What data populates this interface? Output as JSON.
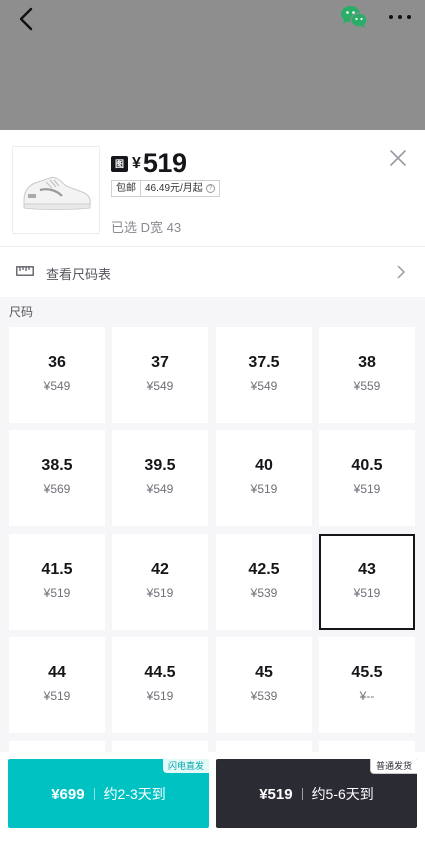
{
  "product": {
    "badge": "图鞋",
    "currency": "¥",
    "price": "519",
    "tag_shipping": "包邮",
    "tag_installment": "46.49元/月起",
    "selected": "已选 D宽 43"
  },
  "size_chart": {
    "label": "查看尺码表"
  },
  "sizes": {
    "title": "尺码",
    "items": [
      {
        "size": "36",
        "price": "¥549"
      },
      {
        "size": "37",
        "price": "¥549"
      },
      {
        "size": "37.5",
        "price": "¥549"
      },
      {
        "size": "38",
        "price": "¥559"
      },
      {
        "size": "38.5",
        "price": "¥569"
      },
      {
        "size": "39.5",
        "price": "¥549"
      },
      {
        "size": "40",
        "price": "¥519"
      },
      {
        "size": "40.5",
        "price": "¥519"
      },
      {
        "size": "41.5",
        "price": "¥519"
      },
      {
        "size": "42",
        "price": "¥519"
      },
      {
        "size": "42.5",
        "price": "¥539"
      },
      {
        "size": "43",
        "price": "¥519"
      },
      {
        "size": "44",
        "price": "¥519"
      },
      {
        "size": "44.5",
        "price": "¥519"
      },
      {
        "size": "45",
        "price": "¥539"
      },
      {
        "size": "45.5",
        "price": "¥--"
      }
    ],
    "selected_size": "43"
  },
  "buy_options": {
    "fast": {
      "badge": "闪电直发",
      "price": "¥699",
      "eta": "约2-3天到",
      "color": "#01c2c3"
    },
    "normal": {
      "badge": "普通发货",
      "price": "¥519",
      "eta": "约5-6天到",
      "color": "#2b2b34"
    }
  }
}
